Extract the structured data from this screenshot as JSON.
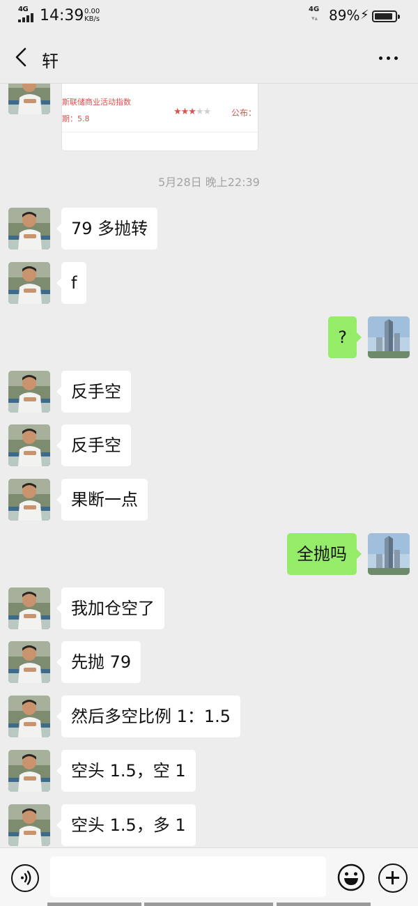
{
  "status_bar": {
    "network_left": "4G",
    "time": "14:39",
    "speed_value": "0.00",
    "speed_unit": "KB/s",
    "network_right": "4G",
    "battery_percent": "89%",
    "battery_level": 0.89
  },
  "header": {
    "title": "轩",
    "back_icon": "chevron-left-icon",
    "more_icon": "more-horizontal-icon"
  },
  "shared_card": {
    "title": "斯联储商业活动指数",
    "value_text": "期：5.8",
    "stars_on": "★★★",
    "stars_off": "★★",
    "stars_rating": 3,
    "stars_max": 5,
    "publish_label": "公布："
  },
  "timestamp": "5月28日 晚上22:39",
  "messages": [
    {
      "side": "left",
      "text": "79 多抛转"
    },
    {
      "side": "left",
      "text": "f"
    },
    {
      "side": "right",
      "text": "?"
    },
    {
      "side": "left",
      "text": "反手空"
    },
    {
      "side": "left",
      "text": "反手空"
    },
    {
      "side": "left",
      "text": "果断一点"
    },
    {
      "side": "right",
      "text": "全抛吗"
    },
    {
      "side": "left",
      "text": "我加仓空了"
    },
    {
      "side": "left",
      "text": "先抛 79"
    },
    {
      "side": "left",
      "text": "然后多空比例 1：1.5"
    },
    {
      "side": "left",
      "text": "空头 1.5，空 1"
    },
    {
      "side": "left",
      "text": "空头 1.5，多 1"
    }
  ],
  "input_bar": {
    "placeholder": "",
    "voice_icon": "voice-icon",
    "emoji_icon": "emoji-icon",
    "plus_icon": "plus-icon"
  },
  "colors": {
    "background": "#ededed",
    "bubble_left": "#ffffff",
    "bubble_right": "#95ec69",
    "card_accent": "#d9534f",
    "timestamp": "#a3a3a3"
  }
}
